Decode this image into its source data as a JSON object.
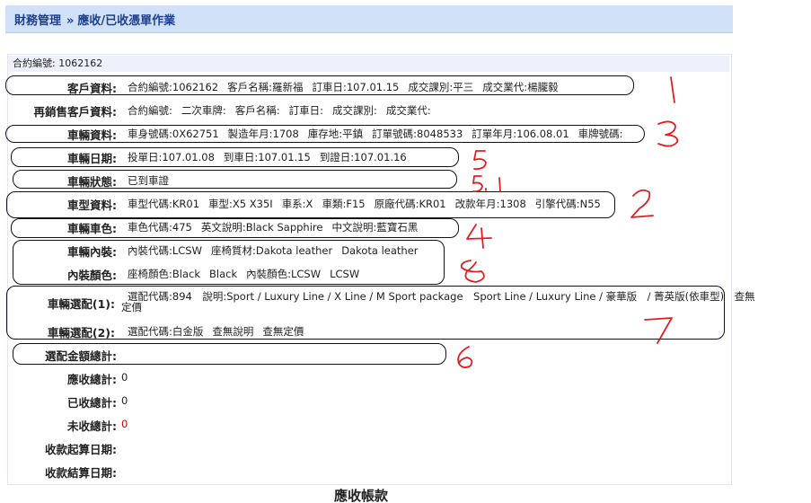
{
  "breadcrumb": {
    "root": "財務管理",
    "separator": "»",
    "current": "應收/已收憑單作業"
  },
  "contract_bar": "合約編號: 1062162",
  "rows": {
    "customer": {
      "label": "客戶資料:",
      "items": [
        "合約編號:1062162",
        "客戶名稱:羅新福",
        "訂車日:107.01.15",
        "成交課別:平三",
        "成交業代:楊朧毅"
      ]
    },
    "resale": {
      "label": "再銷售客戶資料:",
      "items": [
        "合約編號:",
        "二次車牌:",
        "客戶名稱:",
        "訂車日:",
        "成交課別:",
        "成交業代:"
      ]
    },
    "vehicle": {
      "label": "車輛資料:",
      "items": [
        "車身號碼:0X62751",
        "製造年月:1708",
        "庫存地:平鎮",
        "訂單號碼:8048533",
        "訂單年月:106.08.01",
        "車牌號碼:"
      ]
    },
    "vehicle_dates": {
      "label": "車輛日期:",
      "items": [
        "投單日:107.01.08",
        "到車日:107.01.15",
        "到證日:107.01.16"
      ]
    },
    "vehicle_status": {
      "label": "車輛狀態:",
      "items": [
        "已到車證"
      ]
    },
    "model": {
      "label": "車型資料:",
      "items": [
        "車型代碼:KR01",
        "車型:X5 X35I",
        "車系:X",
        "車類:F15",
        "原廠代碼:KR01",
        "改款年月:1308",
        "引擎代碼:N55"
      ]
    },
    "exterior_color": {
      "label": "車輛車色:",
      "items": [
        "車色代碼:475",
        "英文說明:Black Sapphire",
        "中文說明:藍寶石黑"
      ]
    },
    "interior": {
      "label": "車輛內裝:",
      "items": [
        "內裝代碼:LCSW",
        "座椅質材:Dakota leather",
        "Dakota leather"
      ]
    },
    "interior_color": {
      "label": "內裝顏色:",
      "items": [
        "座椅顏色:Black",
        "Black",
        "內裝顏色:LCSW",
        "LCSW"
      ]
    },
    "option1": {
      "label": "車輛選配(1):",
      "line1": "選配代碼:894　說明:Sport / Luxury Line / X Line / M Sport package　Sport Line / Luxury Line / 豪華版　/ 菁英版(依車型)　查無",
      "line2": "定價"
    },
    "option2": {
      "label": "車輛選配(2):",
      "items": [
        "選配代碼:白金版",
        "查無說明",
        "查無定價"
      ]
    },
    "options_total": {
      "label": "選配金額總計:",
      "value": ""
    },
    "receivable_total": {
      "label": "應收總計:",
      "value": "0"
    },
    "received_total": {
      "label": "已收總計:",
      "value": "0"
    },
    "unreceived_total": {
      "label": "未收總計:",
      "value": "0"
    },
    "collect_start": {
      "label": "收款起算日期:",
      "value": ""
    },
    "collect_end": {
      "label": "收款結算日期:",
      "value": ""
    }
  },
  "footer_title": "應收帳款",
  "annotations": [
    "1",
    "3",
    "5",
    "5.1",
    "2",
    "4",
    "8",
    "7",
    "6"
  ],
  "colors": {
    "header_bg": "#cfe0f7",
    "breadcrumb_text": "#1f3f8f",
    "contract_bg": "#eef1fb",
    "annotation_red": "#e02020",
    "negative_red": "#d00000"
  }
}
